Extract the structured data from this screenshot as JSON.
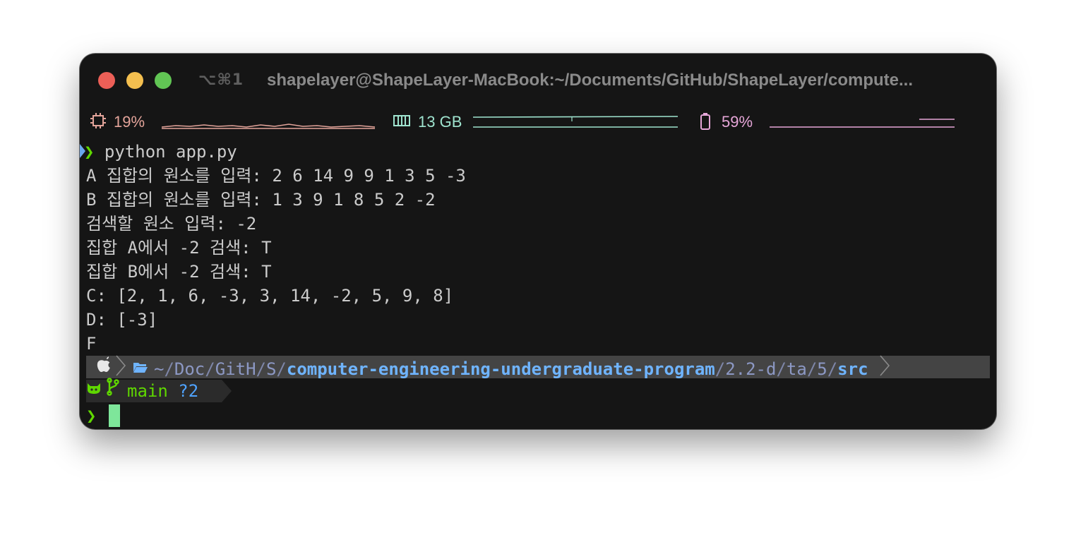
{
  "titlebar": {
    "shortcut": "⌥⌘1",
    "title": "shapelayer@ShapeLayer-MacBook:~/Documents/GitHub/ShapeLayer/compute..."
  },
  "status": {
    "cpu": "19%",
    "memory": "13 GB",
    "battery": "59%",
    "cpu_color": "#e3a49a",
    "memory_color": "#9fe4cf",
    "battery_color": "#e6a6d8"
  },
  "terminal": {
    "command": "python app.py",
    "output": [
      "A 집합의 원소를 입력: 2 6 14 9 9 1 3 5 -3",
      "B 집합의 원소를 입력: 1 3 9 1 8 5 2 -2",
      "검색할 원소 입력: -2",
      "집합 A에서 -2 검색: T",
      "집합 B에서 -2 검색: T",
      "C: [2, 1, 6, -3, 3, 14, -2, 5, 9, 8]",
      "D: [-3]",
      "F"
    ],
    "prompt_symbol": "❯"
  },
  "path": {
    "tilde": "~",
    "seg1": "Doc",
    "seg2": "GitH",
    "seg3": "S",
    "seg4": "computer-engineering-undergraduate-program",
    "seg5": "2.2-d",
    "seg6": "ta",
    "seg7": "5",
    "seg8": "src",
    "slash": "/"
  },
  "git": {
    "branch": "main",
    "status": "?2"
  }
}
